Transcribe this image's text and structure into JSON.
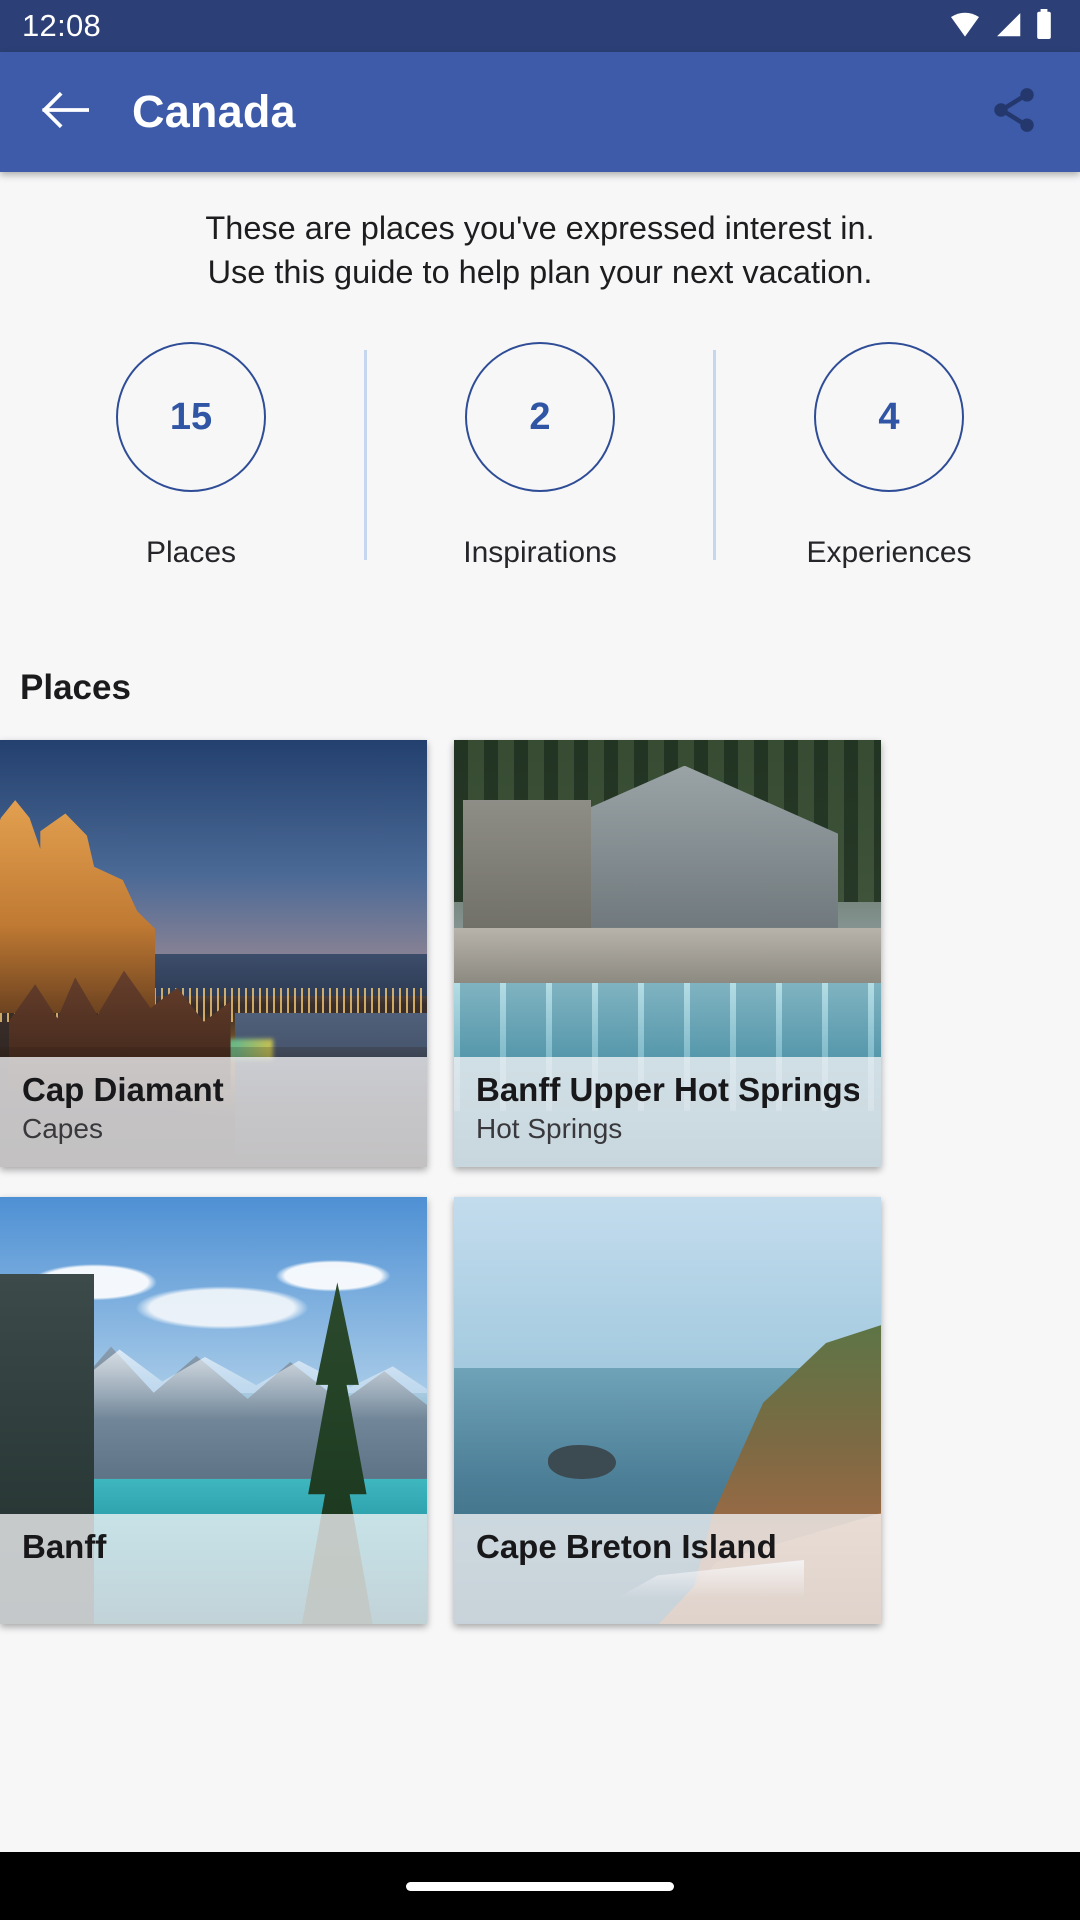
{
  "status_bar": {
    "time": "12:08",
    "icons": [
      "wifi-icon",
      "cellular-signal-icon",
      "battery-icon"
    ],
    "background": "#2c4077"
  },
  "app_bar": {
    "title": "Canada",
    "back_icon": "back-arrow-icon",
    "share_icon": "share-icon",
    "background": "#3d5ba9",
    "title_color": "#ffffff"
  },
  "intro": {
    "line1": "These are places you've expressed interest in.",
    "line2": "Use this guide to help plan your next vacation."
  },
  "stats": {
    "accent_color": "#2f55a4",
    "divider_color": "#c5d7ef",
    "items": [
      {
        "value": "15",
        "label": "Places"
      },
      {
        "value": "2",
        "label": "Inspirations"
      },
      {
        "value": "4",
        "label": "Experiences"
      }
    ]
  },
  "places_section": {
    "heading": "Places",
    "cards": [
      {
        "title": "Cap Diamant",
        "subtitle": "Capes",
        "scene": "sc-quebec"
      },
      {
        "title": "Banff Upper Hot Springs",
        "subtitle": "Hot Springs",
        "scene": "sc-banffsprings"
      },
      {
        "title": "Banff",
        "subtitle": "",
        "scene": "sc-moraine"
      },
      {
        "title": "Cape Breton Island",
        "subtitle": "",
        "scene": "sc-capebreton"
      }
    ]
  },
  "navigation_bar": {
    "gesture_pill": "home-gesture-pill",
    "background": "#000000"
  }
}
